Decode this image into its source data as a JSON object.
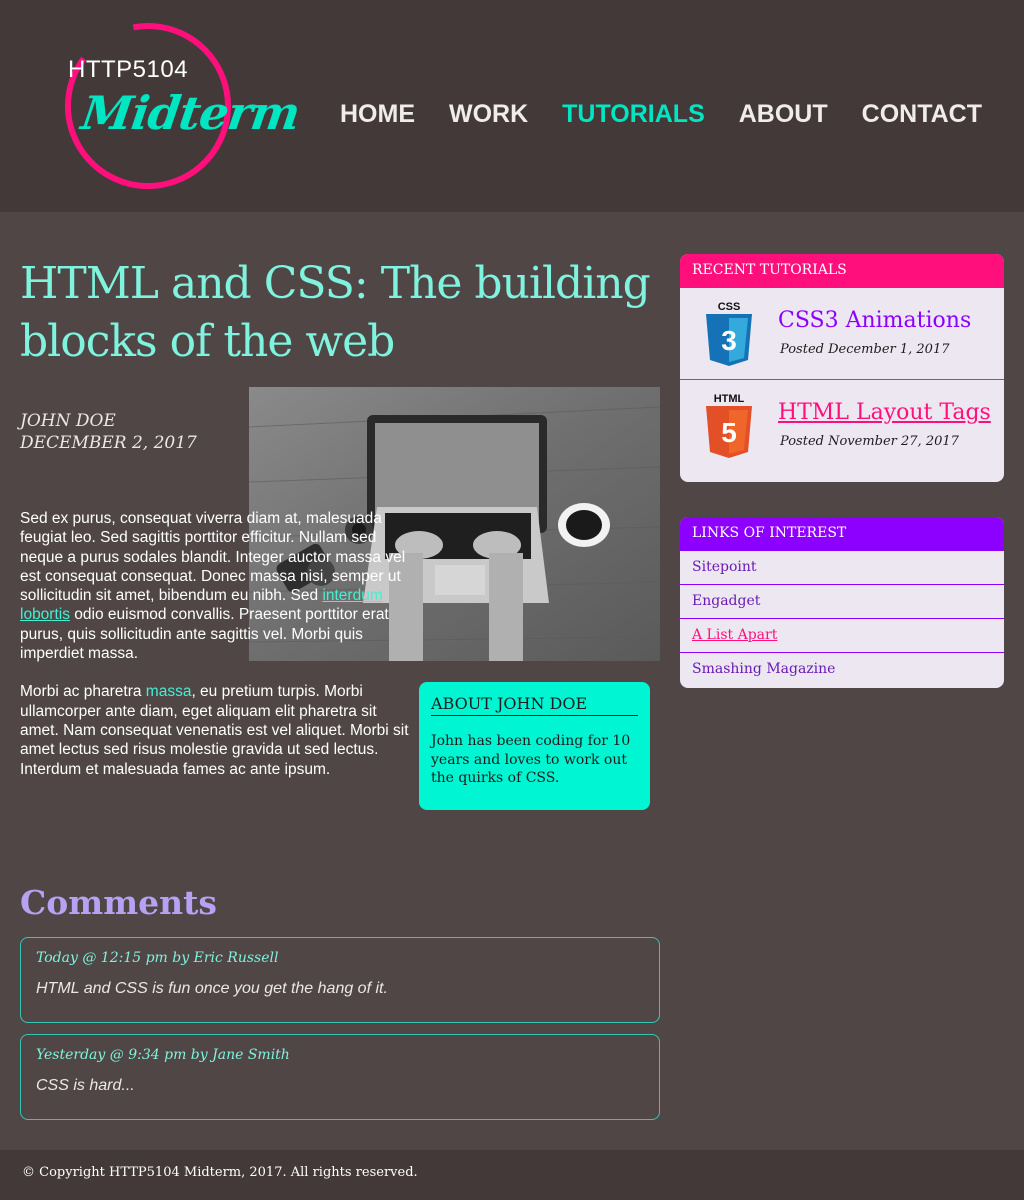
{
  "header": {
    "logo_small": "HTTP5104",
    "logo_big": "Midterm",
    "nav": [
      {
        "label": "HOME"
      },
      {
        "label": "WORK"
      },
      {
        "label": "TUTORIALS",
        "active": true
      },
      {
        "label": "ABOUT"
      },
      {
        "label": "CONTACT"
      }
    ]
  },
  "article": {
    "title": "HTML and CSS: The building blocks of the web",
    "author": "JOHN DOE",
    "date": "DECEMBER 2, 2017",
    "paragraph1_before": "Sed ex purus, consequat viverra diam at, malesuada feugiat leo. Sed sagittis porttitor efficitur. Nullam sed neque a purus sodales blandit. Integer auctor massa vel est consequat consequat. Donec massa nisi, semper ut sollicitudin sit amet, bibendum eu nibh. Sed ",
    "paragraph1_link": "interdum lobortis",
    "paragraph1_after": " odio euismod convallis. Praesent porttitor erat purus, quis sollicitudin ante sagittis vel. Morbi quis imperdiet massa.",
    "paragraph2_before": "Morbi ac pharetra ",
    "paragraph2_link": "massa",
    "paragraph2_after": ", eu pretium turpis. Morbi ullamcorper ante diam, eget aliquam elit pharetra sit amet. Nam consequat venenatis est vel aliquet. Morbi sit amet lectus sed risus molestie gravida ut sed lectus. Interdum et malesuada fames ac ante ipsum.",
    "about": {
      "title": "ABOUT JOHN DOE",
      "text": "John has been coding for 10 years and loves to work out the quirks of CSS."
    }
  },
  "comments": {
    "heading": "Comments",
    "items": [
      {
        "meta": "Today @ 12:15 pm by Eric Russell",
        "text": "HTML and CSS is fun once you get the hang of it."
      },
      {
        "meta": "Yesterday @ 9:34 pm by Jane Smith",
        "text": "CSS is hard..."
      }
    ]
  },
  "sidebar": {
    "recent": {
      "heading": "RECENT TUTORIALS",
      "items": [
        {
          "icon": "css3-icon",
          "icon_text": "CSS",
          "title": "CSS3 Animations",
          "date": "Posted December 1, 2017",
          "color": "#8d00ff"
        },
        {
          "icon": "html5-icon",
          "icon_text": "HTML",
          "title": "HTML Layout Tags",
          "date": "Posted November 27, 2017",
          "color": "#ff0f7c"
        }
      ]
    },
    "links": {
      "heading": "LINKS OF INTEREST",
      "items": [
        {
          "label": "Sitepoint"
        },
        {
          "label": "Engadget"
        },
        {
          "label": "A List Apart"
        },
        {
          "label": "Smashing Magazine"
        }
      ]
    }
  },
  "footer": {
    "text": "© Copyright HTTP5104 Midterm, 2017. All rights reserved."
  },
  "colors": {
    "accent_teal": "#00e6c2",
    "accent_pink": "#ff0f7c",
    "accent_purple": "#8d00ff",
    "background": "#504646",
    "header_bg": "#433939"
  }
}
